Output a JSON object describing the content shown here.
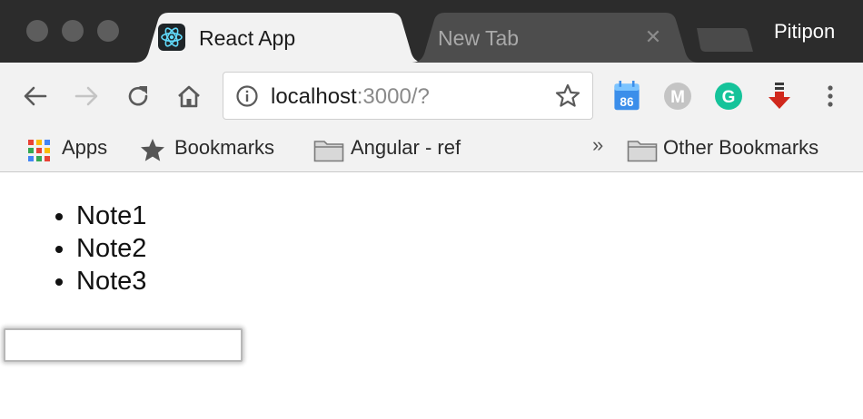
{
  "window": {
    "profile_name": "Pitipon"
  },
  "tabs": [
    {
      "title": "React App",
      "active": true,
      "favicon": "react-icon"
    },
    {
      "title": "New Tab",
      "active": false
    }
  ],
  "toolbar": {
    "back_icon": "back-arrow-icon",
    "forward_icon": "forward-arrow-icon",
    "reload_icon": "reload-icon",
    "home_icon": "home-icon",
    "url_host": "localhost",
    "url_rest": ":3000/?",
    "info_icon": "info-icon",
    "bookmark_star_icon": "star-icon",
    "extensions": [
      {
        "name": "calendar-extension-icon",
        "badge": "86",
        "color": "#3b8eea"
      },
      {
        "name": "m-extension-icon",
        "letter": "M",
        "color": "#bdbdbd"
      },
      {
        "name": "grammarly-extension-icon",
        "letter": "G",
        "color": "#15c39a"
      },
      {
        "name": "download-extension-icon",
        "color": "#d0281c"
      }
    ],
    "menu_icon": "kebab-menu-icon"
  },
  "bookmarks": {
    "items": [
      {
        "label": "Apps",
        "icon": "apps-grid-icon"
      },
      {
        "label": "Bookmarks",
        "icon": "star-icon"
      },
      {
        "label": "Angular - ref",
        "icon": "folder-icon"
      }
    ],
    "overflow": "»",
    "other": {
      "label": "Other Bookmarks",
      "icon": "folder-icon"
    }
  },
  "page": {
    "notes": [
      "Note1",
      "Note2",
      "Note3"
    ],
    "input_value": ""
  }
}
